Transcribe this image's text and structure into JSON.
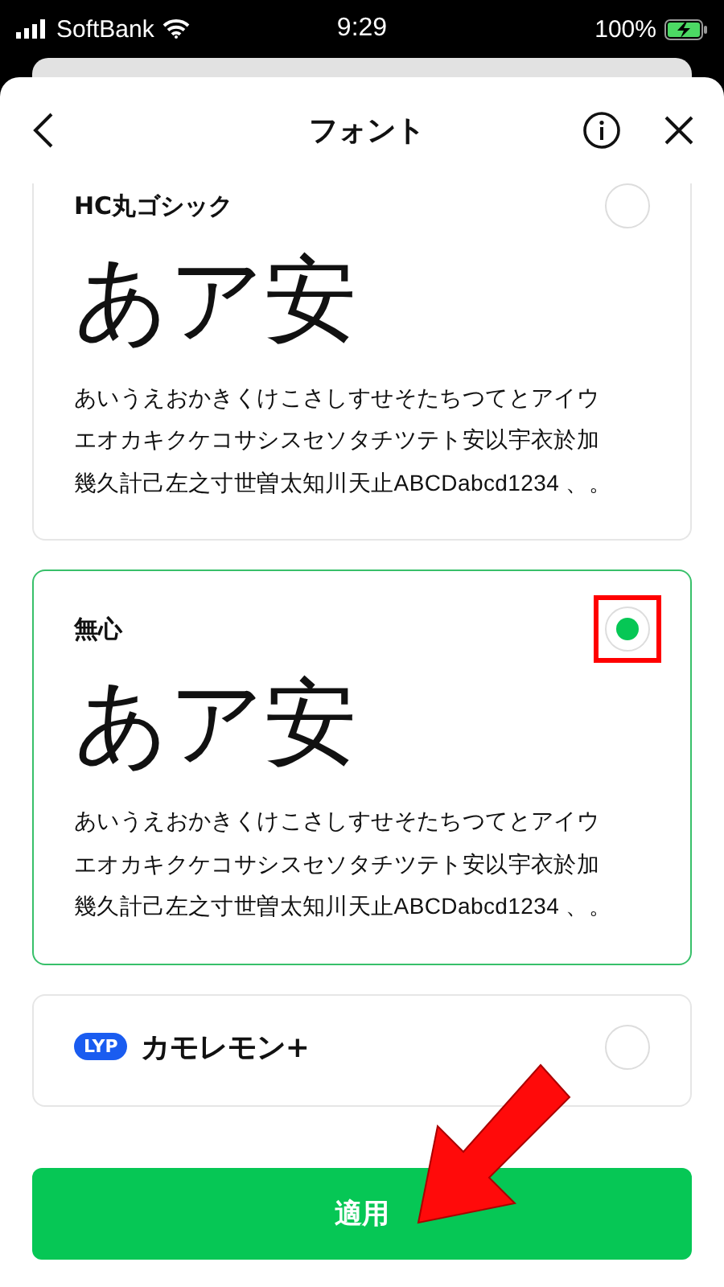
{
  "status_bar": {
    "carrier": "SoftBank",
    "time": "9:29",
    "battery": "100%"
  },
  "header": {
    "title": "フォント"
  },
  "fonts": [
    {
      "name": "HC丸ゴシック",
      "sample_large": "あア安",
      "sample_text": "あいうえおかきくけこさしすせそたちつてとアイウエオカキクケコサシスセソタチツテト安以宇衣於加幾久計己左之寸世曽太知川天止ABCDabcd1234 、。",
      "selected": false
    },
    {
      "name": "無心",
      "sample_large": "あア安",
      "sample_text": "あいうえおかきくけこさしすせそたちつてとアイウエオカキクケコサシスセソタチツテト安以宇衣於加幾久計己左之寸世曽太知川天止ABCDabcd1234 、。",
      "selected": true
    },
    {
      "name": "カモレモン+",
      "badge": "LYP",
      "selected": false
    }
  ],
  "apply_button": {
    "label": "適用"
  }
}
